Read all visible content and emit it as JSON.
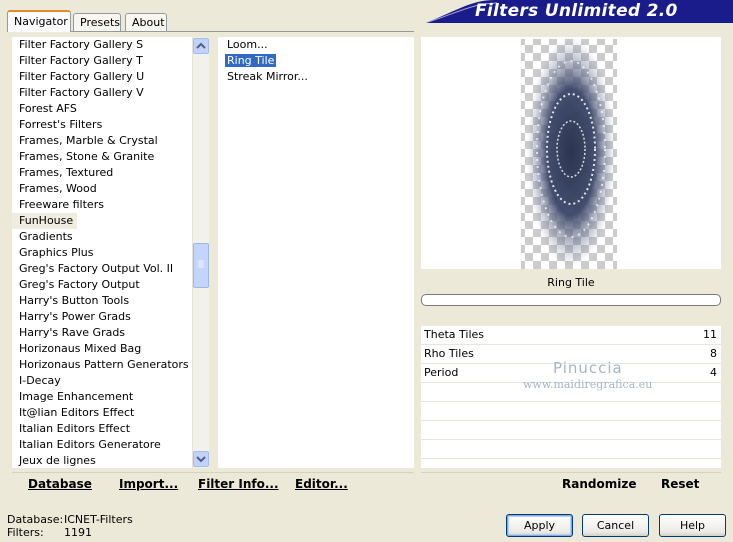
{
  "tabs": [
    {
      "label": "Navigator",
      "active": true
    },
    {
      "label": "Presets",
      "active": false
    },
    {
      "label": "About",
      "active": false
    }
  ],
  "banner": {
    "title": "Filters Unlimited 2.0",
    "color": "#1a1c8c"
  },
  "categories": [
    "Filter Factory Gallery S",
    "Filter Factory Gallery T",
    "Filter Factory Gallery U",
    "Filter Factory Gallery V",
    "Forest AFS",
    "Forrest's Filters",
    "Frames, Marble & Crystal",
    "Frames, Stone & Granite",
    "Frames, Textured",
    "Frames, Wood",
    "Freeware filters",
    "FunHouse",
    "Gradients",
    "Graphics Plus",
    "Greg's Factory Output Vol. II",
    "Greg's Factory Output",
    "Harry's Button Tools",
    "Harry's Power Grads",
    "Harry's Rave Grads",
    "Horizonaus Mixed Bag",
    "Horizonaus Pattern Generators",
    "I-Decay",
    "Image Enhancement",
    "It@lian Editors Effect",
    "Italian Editors Effect",
    "Italian Editors Generatore",
    "Jeux de lignes"
  ],
  "selected_category_index": 11,
  "filters": [
    "Loom...",
    "Ring Tile",
    "Streak Mirror..."
  ],
  "selected_filter_index": 1,
  "filter_name": "Ring Tile",
  "params": [
    {
      "label": "Theta Tiles",
      "value": "11"
    },
    {
      "label": "Rho Tiles",
      "value": "8"
    },
    {
      "label": "Period",
      "value": "4"
    }
  ],
  "watermark": {
    "name": "Pinuccia",
    "site": "www.maidiregrafica.eu"
  },
  "left_buttons": {
    "database": "Database",
    "import": "Import...",
    "filter_info": "Filter Info...",
    "editor": "Editor..."
  },
  "right_buttons": {
    "randomize": "Randomize",
    "reset": "Reset"
  },
  "info": {
    "database_label": "Database:",
    "database_value": "ICNET-Filters",
    "filters_label": "Filters:",
    "filters_value": "1191"
  },
  "dialog_buttons": {
    "apply": "Apply",
    "cancel": "Cancel",
    "help": "Help"
  },
  "icons": {
    "scroll_up": "chevron-up-icon",
    "scroll_down": "chevron-down-icon"
  }
}
